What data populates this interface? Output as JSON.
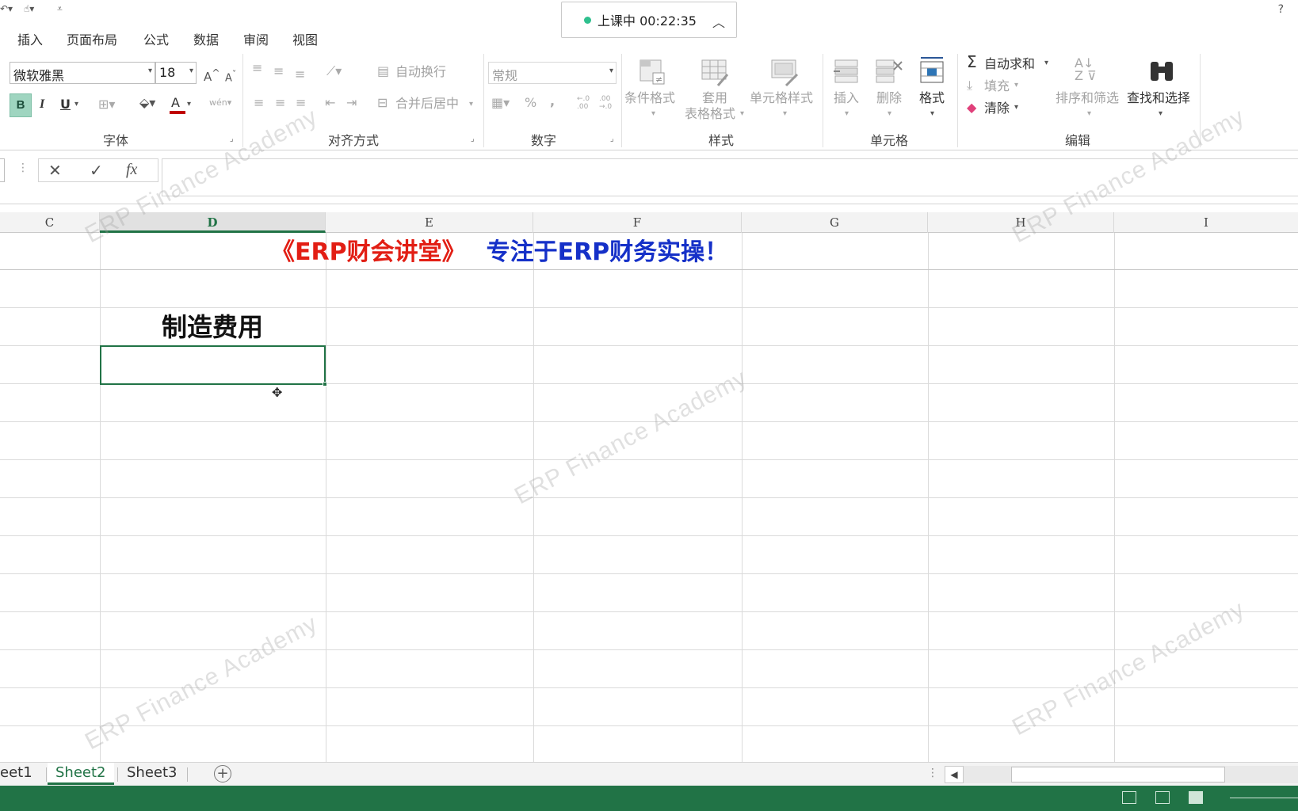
{
  "timer": {
    "label": "上课中 00:22:35"
  },
  "help": "?",
  "ribbon_tabs": [
    "插入",
    "页面布局",
    "公式",
    "数据",
    "审阅",
    "视图"
  ],
  "font_group": {
    "font_name": "微软雅黑",
    "font_size": "18",
    "grow": "A",
    "shrink": "A",
    "bold": "B",
    "italic": "I",
    "underline": "U",
    "font_color_glyph": "A",
    "wen": "wén",
    "label": "字体"
  },
  "align_group": {
    "wrap_text": "自动换行",
    "merge_center": "合并后居中",
    "label": "对齐方式"
  },
  "number_group": {
    "format": "常规",
    "percent": "%",
    "comma": ",",
    "inc_decimal": "←.0 .00",
    "dec_decimal": ".00 →.0",
    "label": "数字"
  },
  "styles_group": {
    "conditional": "条件格式",
    "table_line1": "套用",
    "table_line2": "表格格式",
    "cell_styles": "单元格样式",
    "label": "样式"
  },
  "cells_group": {
    "insert": "插入",
    "delete": "删除",
    "format": "格式",
    "label": "单元格"
  },
  "editing_group": {
    "autosum": "自动求和",
    "fill": "填充",
    "clear": "清除",
    "sort_filter": "排序和筛选",
    "find_select": "查找和选择",
    "label": "编辑"
  },
  "formula_bar": {
    "cancel": "✕",
    "enter": "✓",
    "fx": "fx",
    "value": ""
  },
  "columns": [
    "C",
    "D",
    "E",
    "F",
    "G",
    "H",
    "I"
  ],
  "selected_column": "D",
  "cells": {
    "banner_red": "《ERP财会讲堂》",
    "banner_blue": "专注于ERP财务实操！",
    "heading": "制造费用",
    "selected_value": ""
  },
  "watermark": "ERP Finance Academy",
  "sheets": [
    "eet1",
    "Sheet2",
    "Sheet3"
  ],
  "active_sheet": "Sheet2",
  "colors": {
    "excel_green": "#217346",
    "banner_red": "#e21e14",
    "banner_blue": "#1530c8"
  }
}
